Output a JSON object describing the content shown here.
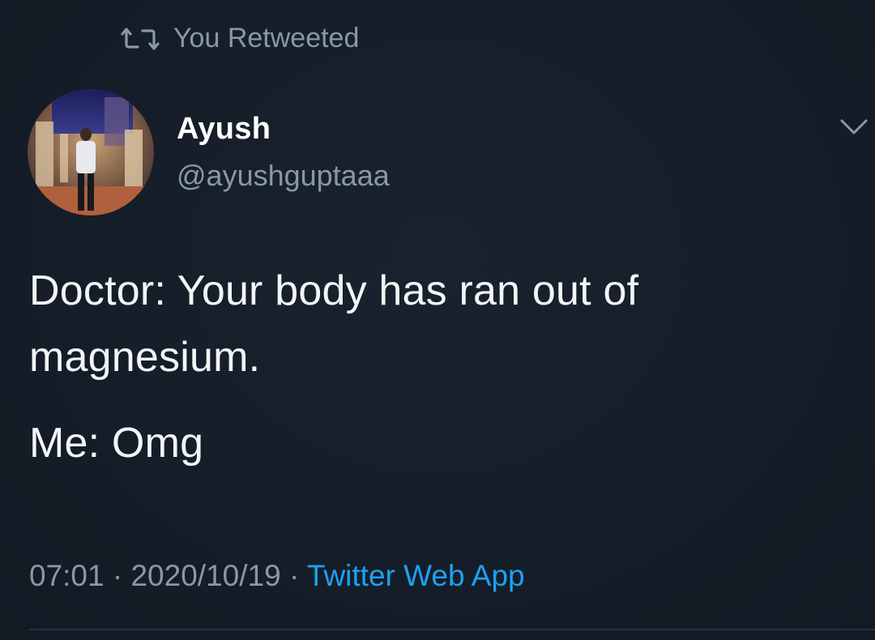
{
  "retweet": {
    "label": "You Retweeted",
    "icon": "retweet-icon"
  },
  "author": {
    "name": "Ayush",
    "handle": "@ayushguptaaa",
    "avatar_icon": "profile-photo"
  },
  "menu": {
    "icon": "chevron-down-icon"
  },
  "tweet": {
    "line1": "Doctor: Your body has ran out of magnesium.",
    "line2": "Me: Omg"
  },
  "meta": {
    "time": "07:01",
    "date": "2020/10/19",
    "separator": "·",
    "source": "Twitter Web App"
  },
  "colors": {
    "background": "#15202b",
    "secondary_text": "#8899a6",
    "link": "#1da1f2",
    "primary_text": "#ffffff"
  }
}
